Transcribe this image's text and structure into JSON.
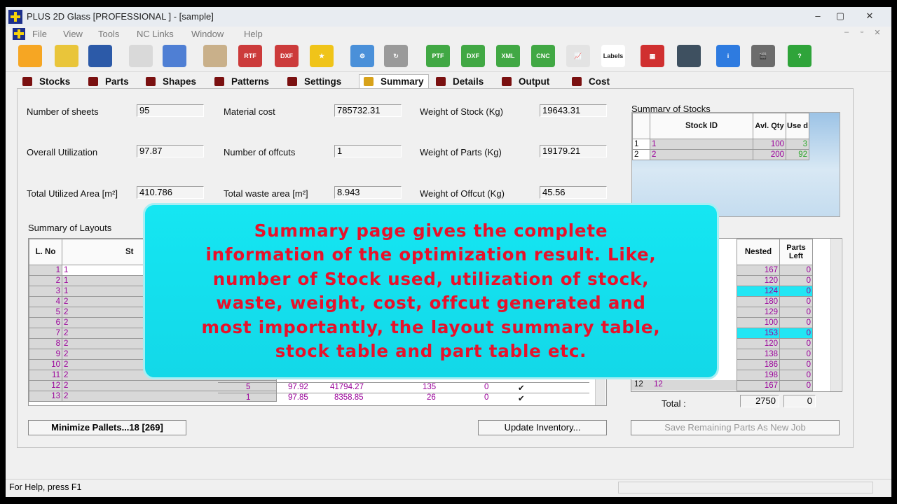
{
  "window": {
    "title": "PLUS 2D Glass [PROFESSIONAL ] - [sample]",
    "min": "–",
    "max": "▢",
    "close": "✕"
  },
  "menu": [
    "File",
    "View",
    "Tools",
    "NC Links",
    "Window",
    "Help"
  ],
  "toolbar_icons": [
    {
      "name": "new-icon",
      "text": "",
      "bg": "#f6a623"
    },
    {
      "name": "open-icon",
      "text": "",
      "bg": "#e9c53a"
    },
    {
      "name": "save-icon",
      "text": "",
      "bg": "#2c5aa8"
    },
    {
      "name": "properties-icon",
      "text": "",
      "bg": "#d9d9d9"
    },
    {
      "name": "check-icon",
      "text": "",
      "bg": "#4f7fd4"
    },
    {
      "name": "palette-icon",
      "text": "",
      "bg": "#c9b08a"
    },
    {
      "name": "export-rtf-icon",
      "text": "RTF",
      "bg": "#cc3b3b"
    },
    {
      "name": "export-dxf-icon",
      "text": "DXF",
      "bg": "#cc3b3b"
    },
    {
      "name": "star-icon",
      "text": "★",
      "bg": "#f0c419"
    },
    {
      "name": "gear-icon",
      "text": "⚙",
      "bg": "#4a90d9"
    },
    {
      "name": "reload-icon",
      "text": "↻",
      "bg": "#9a9a9a"
    },
    {
      "name": "export-ptf-icon",
      "text": "PTF",
      "bg": "#41a844"
    },
    {
      "name": "export-dxf2-icon",
      "text": "DXF",
      "bg": "#41a844"
    },
    {
      "name": "export-xml-icon",
      "text": "XML",
      "bg": "#41a844"
    },
    {
      "name": "export-cnc-icon",
      "text": "CNC",
      "bg": "#41a844"
    },
    {
      "name": "chart-icon",
      "text": "📈",
      "bg": "#e3e3e3"
    },
    {
      "name": "labels-icon",
      "text": "Labels",
      "bg": "#ffffff"
    },
    {
      "name": "grid-icon",
      "text": "▦",
      "bg": "#d03030"
    },
    {
      "name": "film-icon",
      "text": "",
      "bg": "#3e5060"
    },
    {
      "name": "info-icon",
      "text": "i",
      "bg": "#2e7be0"
    },
    {
      "name": "video-icon",
      "text": "🎬",
      "bg": "#6c6c6c"
    },
    {
      "name": "help-icon",
      "text": "?",
      "bg": "#2fa43a"
    }
  ],
  "tabs": [
    "Stocks",
    "Parts",
    "Shapes",
    "Patterns",
    "Settings",
    "Summary",
    "Details",
    "Output",
    "Cost"
  ],
  "metrics": {
    "sheets_label": "Number of sheets",
    "sheets": "95",
    "material_cost_label": "Material cost",
    "material_cost": "785732.31",
    "stock_weight_label": "Weight of Stock (Kg)",
    "stock_weight": "19643.31",
    "util_label": "Overall Utilization",
    "util": "97.87",
    "offcuts_label": "Number of offcuts",
    "offcuts": "1",
    "parts_weight_label": "Weight of Parts (Kg)",
    "parts_weight": "19179.21",
    "area_label": "Total Utilized Area [m²]",
    "area": "410.786",
    "waste_label": "Total waste area [m²]",
    "waste": "8.943",
    "offcut_weight_label": "Weight of Offcut (Kg)",
    "offcut_weight": "45.56"
  },
  "stocks_summary": {
    "title": "Summary of Stocks",
    "headers": [
      "Stock ID",
      "Avl. Qty",
      "Use d"
    ],
    "rows": [
      {
        "n": "1",
        "id": "1",
        "avl": "100",
        "used": "3"
      },
      {
        "n": "2",
        "id": "2",
        "avl": "200",
        "used": "92"
      }
    ]
  },
  "layouts": {
    "title": "Summary of Layouts",
    "headers": [
      "L. No",
      "St"
    ],
    "rows": [
      {
        "n": "1",
        "s": "1"
      },
      {
        "n": "2",
        "s": "1"
      },
      {
        "n": "3",
        "s": "1"
      },
      {
        "n": "4",
        "s": "2"
      },
      {
        "n": "5",
        "s": "2"
      },
      {
        "n": "6",
        "s": "2"
      },
      {
        "n": "7",
        "s": "2"
      },
      {
        "n": "8",
        "s": "2"
      },
      {
        "n": "9",
        "s": "2"
      },
      {
        "n": "10",
        "s": "2"
      },
      {
        "n": "11",
        "s": "2"
      },
      {
        "n": "12",
        "s": "2"
      },
      {
        "n": "13",
        "s": "2"
      }
    ],
    "visible_rows": [
      {
        "n": "12",
        "a": "5",
        "b": "97.92",
        "c": "41794.27",
        "d": "135",
        "e": "0",
        "chk": "✔"
      },
      {
        "n": "13",
        "a": "1",
        "b": "97.85",
        "c": "8358.85",
        "d": "26",
        "e": "0",
        "chk": "✔"
      }
    ]
  },
  "parts_summary": {
    "headers": [
      "Nested",
      "Parts Left"
    ],
    "rows": [
      {
        "nested": "167",
        "left": "0"
      },
      {
        "nested": "120",
        "left": "0"
      },
      {
        "nested": "124",
        "left": "0",
        "hl": true
      },
      {
        "nested": "180",
        "left": "0"
      },
      {
        "nested": "129",
        "left": "0"
      },
      {
        "nested": "100",
        "left": "0"
      },
      {
        "nested": "153",
        "left": "0",
        "hl": true
      },
      {
        "nested": "120",
        "left": "0"
      },
      {
        "nested": "138",
        "left": "0"
      },
      {
        "nested": "186",
        "left": "0"
      },
      {
        "nested": "198",
        "left": "0"
      },
      {
        "nested": "167",
        "left": "0",
        "n": "12",
        "id": "12"
      }
    ],
    "total_label": "Total :",
    "total": "2750",
    "total_left": "0"
  },
  "overlay": {
    "lines": [
      "Summary page gives the complete",
      "information of the optimization result. Like,",
      "number of Stock used, utilization of stock,",
      "waste, weight, cost, offcut generated and",
      "most importantly, the layout summary table,",
      "stock table and part table etc."
    ]
  },
  "buttons": {
    "minimize": "Minimize Pallets...18 [269]",
    "update": "Update Inventory...",
    "save_remaining": "Save Remaining Parts As New Job"
  },
  "status": "For Help, press F1"
}
